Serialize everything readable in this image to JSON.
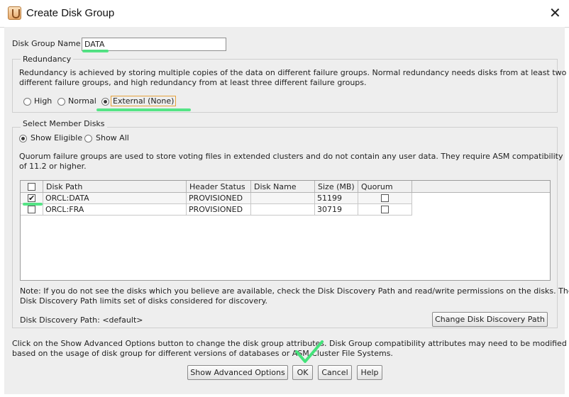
{
  "window": {
    "title": "Create Disk Group",
    "icon": "java-cup-icon",
    "close_icon": "close-icon"
  },
  "disk_group_name": {
    "label": "Disk Group Name",
    "value": "DATA"
  },
  "redundancy": {
    "title": "Redundancy",
    "description_line1": "Redundancy is achieved by storing multiple copies of the data on different failure groups. Normal redundancy needs disks from at least two",
    "description_line2": "different failure groups, and high redundancy from at least three different failure groups.",
    "options": [
      {
        "label": "High",
        "selected": false
      },
      {
        "label": "Normal",
        "selected": false
      },
      {
        "label": "External (None)",
        "selected": true
      }
    ]
  },
  "member_disks": {
    "title": "Select Member Disks",
    "filters": [
      {
        "label": "Show Eligible",
        "selected": true
      },
      {
        "label": "Show All",
        "selected": false
      }
    ],
    "quorum_note_line1": "Quorum failure groups are used to store voting files in extended clusters and do not contain any user data. They require ASM compatibility",
    "quorum_note_line2": "of 11.2 or higher.",
    "table": {
      "columns": [
        "",
        "Disk Path",
        "Header Status",
        "Disk Name",
        "Size (MB)",
        "Quorum"
      ],
      "rows": [
        {
          "selected": true,
          "disk_path": "ORCL:DATA",
          "header_status": "PROVISIONED",
          "disk_name": "",
          "size_mb": "51199",
          "quorum": false
        },
        {
          "selected": false,
          "disk_path": "ORCL:FRA",
          "header_status": "PROVISIONED",
          "disk_name": "",
          "size_mb": "30719",
          "quorum": false
        }
      ]
    },
    "note_line1": "Note: If you do not see the disks which you believe are available, check the Disk Discovery Path and read/write permissions on the disks. The",
    "note_line2": "Disk Discovery Path limits set of disks considered for discovery.",
    "discovery_path_label": "Disk Discovery Path: <default>",
    "change_path_button": "Change Disk Discovery Path"
  },
  "footer": {
    "text_line1": "Click on the Show Advanced Options button to change the disk group attributes. Disk Group compatibility attributes may need to be modified",
    "text_line2": "based on the usage of disk group for different versions of databases or ASM Cluster File Systems.",
    "buttons": {
      "advanced": "Show Advanced Options",
      "ok": "OK",
      "cancel": "Cancel",
      "help": "Help"
    }
  },
  "colors": {
    "highlight_marker": "#44e27a",
    "focus_outline": "#e6a23c",
    "panel_bg": "#eeeeee"
  }
}
